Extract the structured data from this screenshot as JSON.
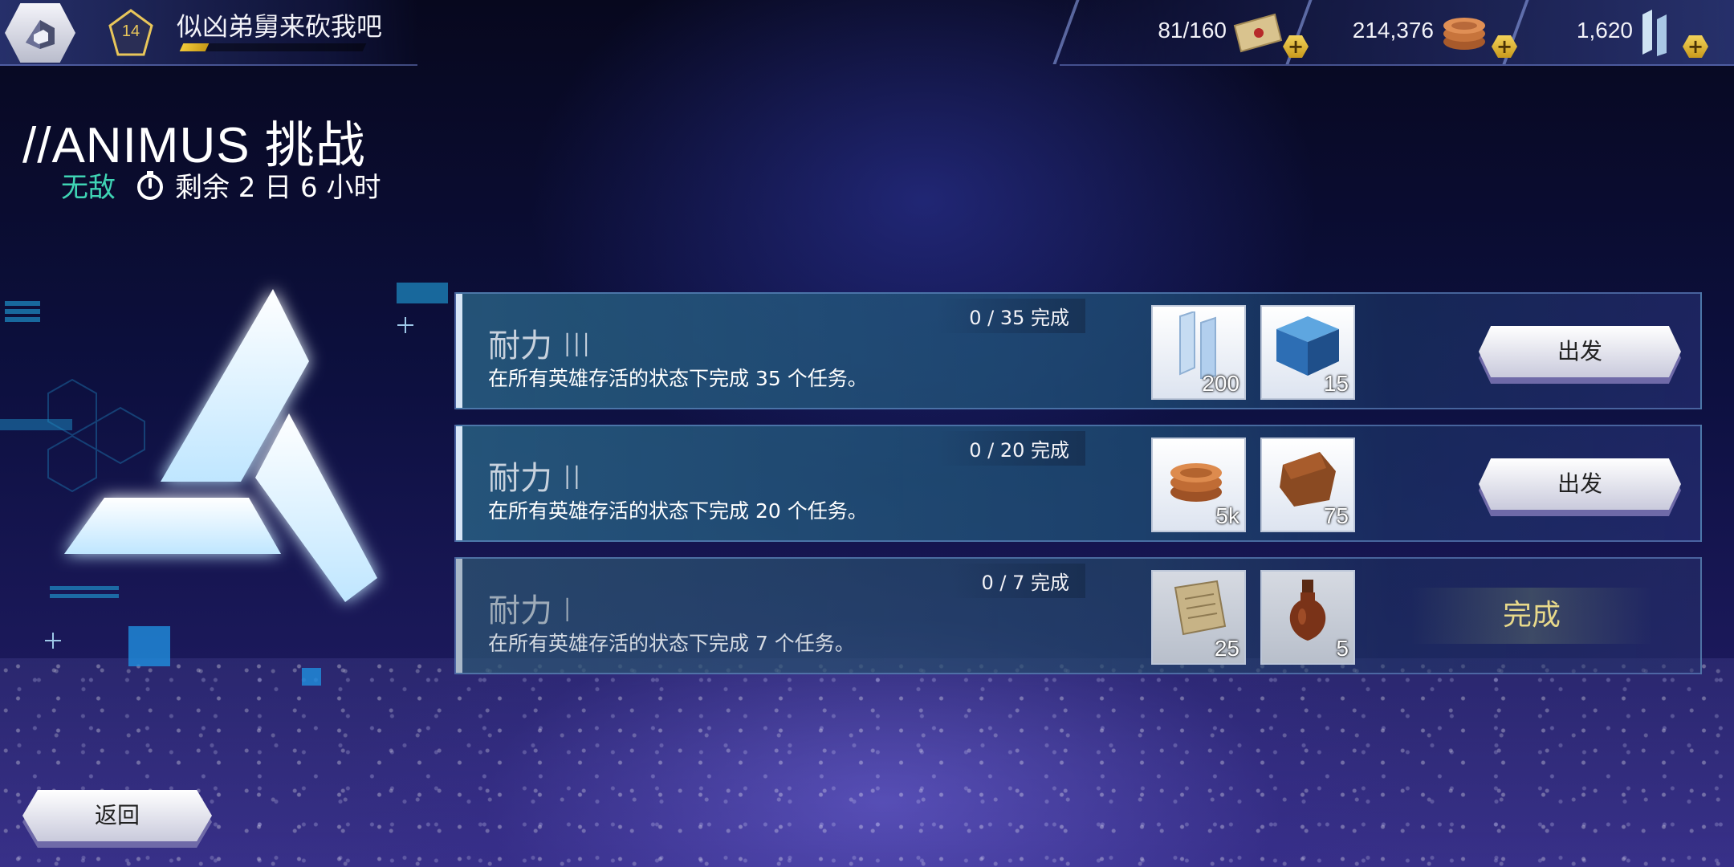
{
  "player": {
    "level": "14",
    "name": "似凶弟舅来砍我吧",
    "xp_fraction": 0.14
  },
  "currencies": [
    {
      "value": "81/160",
      "icon": "letter-icon"
    },
    {
      "value": "214,376",
      "icon": "coins-icon"
    },
    {
      "value": "1,620",
      "icon": "crystal-icon"
    }
  ],
  "plus_label": "+",
  "title": "//ANIMUS 挑战",
  "status": "无敌",
  "remaining": "剩余 2 日 6 小时",
  "challenges": [
    {
      "name": "耐力 III",
      "progress": "0 / 35 完成",
      "desc": "在所有英雄存活的状态下完成 35 个任务。",
      "rewards": [
        {
          "icon": "crystal-icon",
          "qty": "200"
        },
        {
          "icon": "cube-icon",
          "qty": "15"
        }
      ],
      "action": "出发"
    },
    {
      "name": "耐力 II",
      "progress": "0 / 20 完成",
      "desc": "在所有英雄存活的状态下完成 20 个任务。",
      "rewards": [
        {
          "icon": "coins-icon",
          "qty": "5k"
        },
        {
          "icon": "leather-icon",
          "qty": "75"
        }
      ],
      "action": "出发"
    },
    {
      "name": "耐力 I",
      "progress": "0 / 7 完成",
      "desc": "在所有英雄存活的状态下完成 7 个任务。",
      "rewards": [
        {
          "icon": "scroll-icon",
          "qty": "25"
        },
        {
          "icon": "potion-icon",
          "qty": "5"
        }
      ],
      "action": "完成"
    }
  ],
  "back_label": "返回"
}
